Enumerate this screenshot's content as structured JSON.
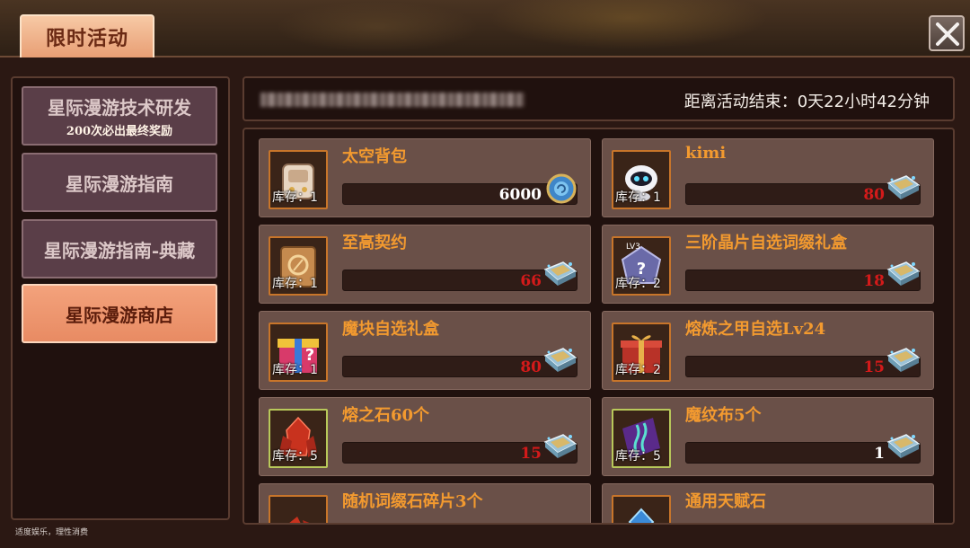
{
  "header": {
    "title": "限时活动"
  },
  "sidebar": {
    "items": [
      {
        "label": "星际漫游技术研发",
        "sub": "200次必出最终奖励"
      },
      {
        "label": "星际漫游指南",
        "sub": ""
      },
      {
        "label": "星际漫游指南-典藏",
        "sub": ""
      },
      {
        "label": "星际漫游商店",
        "sub": ""
      }
    ],
    "active_index": 3
  },
  "countdown": {
    "text": "距离活动结束：0天22小时42分钟"
  },
  "shop": {
    "items": [
      {
        "name": "太空背包",
        "stock": "库存：1",
        "price": "6000",
        "price_color": "#ffffff",
        "currency_icon": "blue-gem-coin-icon",
        "icon": "space-backpack-icon"
      },
      {
        "name": "kimi",
        "stock": "库存：1",
        "price": "80",
        "price_color": "#d41a1a",
        "currency_icon": "ticket-book-icon",
        "icon": "robot-pet-icon"
      },
      {
        "name": "至高契约",
        "stock": "库存：1",
        "price": "66",
        "price_color": "#d41a1a",
        "currency_icon": "ticket-book-icon",
        "icon": "contract-scroll-icon"
      },
      {
        "name": "三阶晶片自选词缀礼盒",
        "stock": "库存：2",
        "price": "18",
        "price_color": "#d41a1a",
        "currency_icon": "ticket-book-icon",
        "icon": "lv3-crystal-box-icon"
      },
      {
        "name": "魔块自选礼盒",
        "stock": "库存：1",
        "price": "80",
        "price_color": "#d41a1a",
        "currency_icon": "ticket-book-icon",
        "icon": "mystery-gift-box-icon"
      },
      {
        "name": "熔炼之甲自选Lv24",
        "stock": "库存：2",
        "price": "15",
        "price_color": "#d41a1a",
        "currency_icon": "ticket-book-icon",
        "icon": "red-gift-box-icon"
      },
      {
        "name": "熔之石60个",
        "stock": "库存：5",
        "price": "15",
        "price_color": "#d41a1a",
        "currency_icon": "ticket-book-icon",
        "icon": "red-crystal-icon"
      },
      {
        "name": "魔纹布5个",
        "stock": "库存：5",
        "price": "1",
        "price_color": "#ffffff",
        "currency_icon": "ticket-book-icon",
        "icon": "purple-cloth-icon"
      },
      {
        "name": "随机词缀石碎片3个",
        "stock": "",
        "price": "",
        "price_color": "#d41a1a",
        "currency_icon": "ticket-book-icon",
        "icon": "red-shard-icon"
      },
      {
        "name": "通用天赋石",
        "stock": "",
        "price": "",
        "price_color": "#d41a1a",
        "currency_icon": "ticket-book-icon",
        "icon": "blue-talent-stone-icon"
      }
    ]
  },
  "footer": {
    "note": "适度娱乐，理性消费"
  },
  "colors": {
    "accent": "#e88b63",
    "item_name": "#f39a2f",
    "price_red": "#d41a1a"
  }
}
